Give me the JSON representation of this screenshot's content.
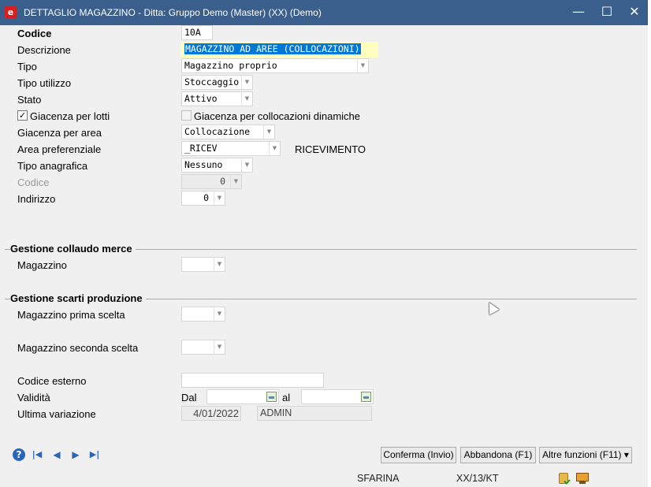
{
  "window": {
    "title": "DETTAGLIO MAGAZZINO - Ditta: Gruppo Demo (Master) (XX)  (Demo)",
    "logo_glyph": "e",
    "minimize": "—",
    "maximize": "☐",
    "close": "✕"
  },
  "form": {
    "codice": {
      "label": "Codice",
      "value": "10A"
    },
    "descrizione": {
      "label": "Descrizione",
      "value": "MAGAZZINO AD AREE (COLLOCAZIONI)"
    },
    "tipo": {
      "label": "Tipo",
      "value": "Magazzino proprio"
    },
    "tipo_utilizzo": {
      "label": "Tipo utilizzo",
      "value": "Stoccaggio"
    },
    "stato": {
      "label": "Stato",
      "value": "Attivo"
    },
    "giacenza_lotti": {
      "label": "Giacenza per lotti",
      "checked": true,
      "check_glyph": "✓"
    },
    "giacenza_collocazioni": {
      "label": "Giacenza per collocazioni dinamiche",
      "checked": false
    },
    "giacenza_area": {
      "label": "Giacenza per area",
      "value": "Collocazione"
    },
    "area_preferenziale": {
      "label": "Area preferenziale",
      "value": "_RICEV",
      "description": "RICEVIMENTO"
    },
    "tipo_anagrafica": {
      "label": "Tipo anagrafica",
      "value": "Nessuno"
    },
    "codice_anagrafica": {
      "label": "Codice",
      "value": "0"
    },
    "indirizzo": {
      "label": "Indirizzo",
      "value": "0"
    }
  },
  "sections": {
    "collaudo": {
      "title": "Gestione collaudo merce",
      "magazzino_label": "Magazzino",
      "magazzino_value": ""
    },
    "scarti": {
      "title": "Gestione scarti produzione",
      "prima_label": "Magazzino prima scelta",
      "prima_value": "",
      "seconda_label": "Magazzino seconda scelta",
      "seconda_value": ""
    }
  },
  "extra": {
    "codice_esterno": {
      "label": "Codice esterno",
      "value": ""
    },
    "validita": {
      "label": "Validità",
      "dal_label": "Dal",
      "dal_value": "",
      "al_label": "al",
      "al_value": ""
    },
    "ultima_variazione": {
      "label": "Ultima variazione",
      "date": "4/01/2022",
      "user": "ADMIN"
    }
  },
  "footer": {
    "help_glyph": "?",
    "nav_first": "|◀",
    "nav_prev": "◀",
    "nav_next": "▶",
    "nav_last": "▶|",
    "confirm_label": "Conferma (Invio)",
    "abandon_label": "Abbandona (F1)",
    "more_label": "Altre funzioni (F11)",
    "more_arrow": "▾"
  },
  "status_bar": {
    "user": "SFARINA",
    "code": "XX/13/KT"
  },
  "icons": {
    "dropdown": "▼",
    "colors": {
      "titlebar": "#3a5f8c",
      "selection": "#0078d7",
      "highlight": "#ffffc0",
      "accent": "#2a66b8"
    }
  }
}
